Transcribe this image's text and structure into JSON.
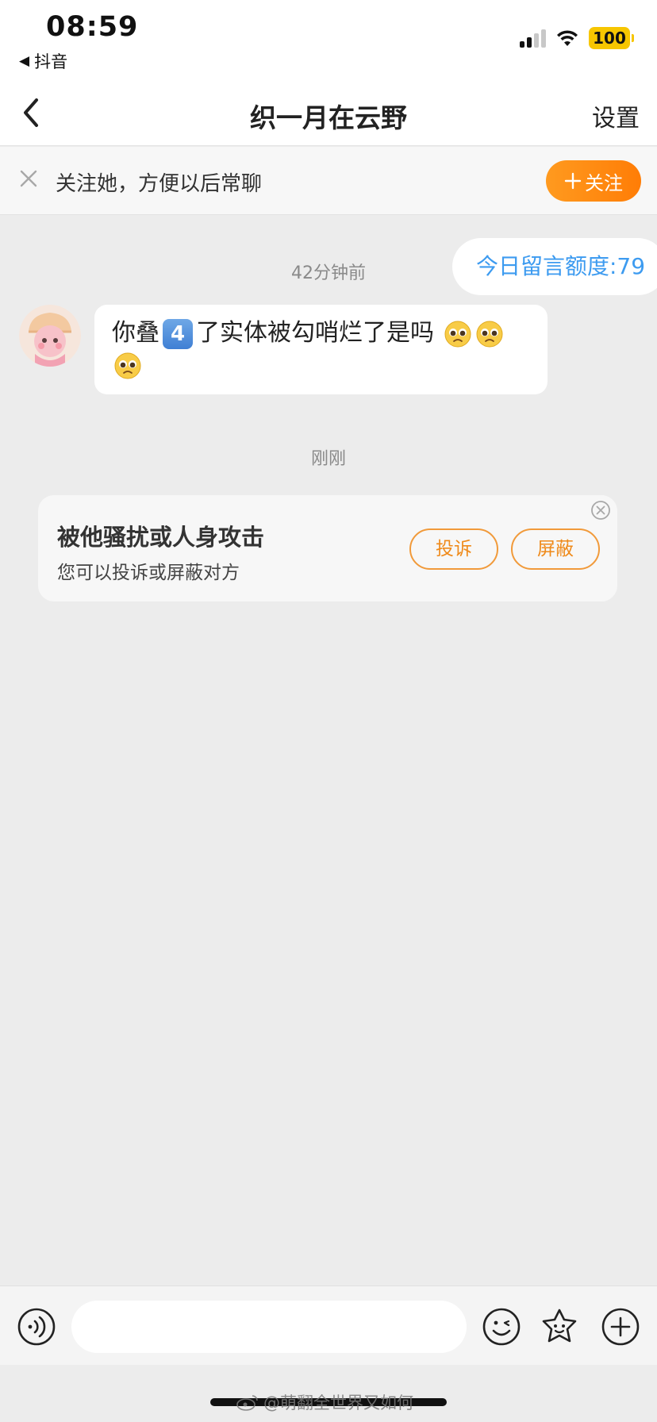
{
  "status_bar": {
    "time": "08:59",
    "back_app": "抖音",
    "battery": "100"
  },
  "nav": {
    "title": "织一月在云野",
    "settings": "设置"
  },
  "follow_strip": {
    "text": "关注她，方便以后常聊",
    "button": "关注"
  },
  "chat": {
    "quota": "今日留言额度:79",
    "time_1": "42分钟前",
    "message": {
      "part_1": "你叠",
      "number_key": "4",
      "part_2": "了实体被勾哨烂了是吗"
    },
    "time_2": "刚刚"
  },
  "harassment_card": {
    "title": "被他骚扰或人身攻击",
    "subtitle": "您可以投诉或屏蔽对方",
    "report": "投诉",
    "block": "屏蔽"
  },
  "input_bar": {
    "placeholder": ""
  },
  "watermark": "@萌翻全世界又如何",
  "colors": {
    "accent_orange": "#ff8a12",
    "link_blue": "#3d9bf0",
    "chat_bg": "#ececec"
  }
}
